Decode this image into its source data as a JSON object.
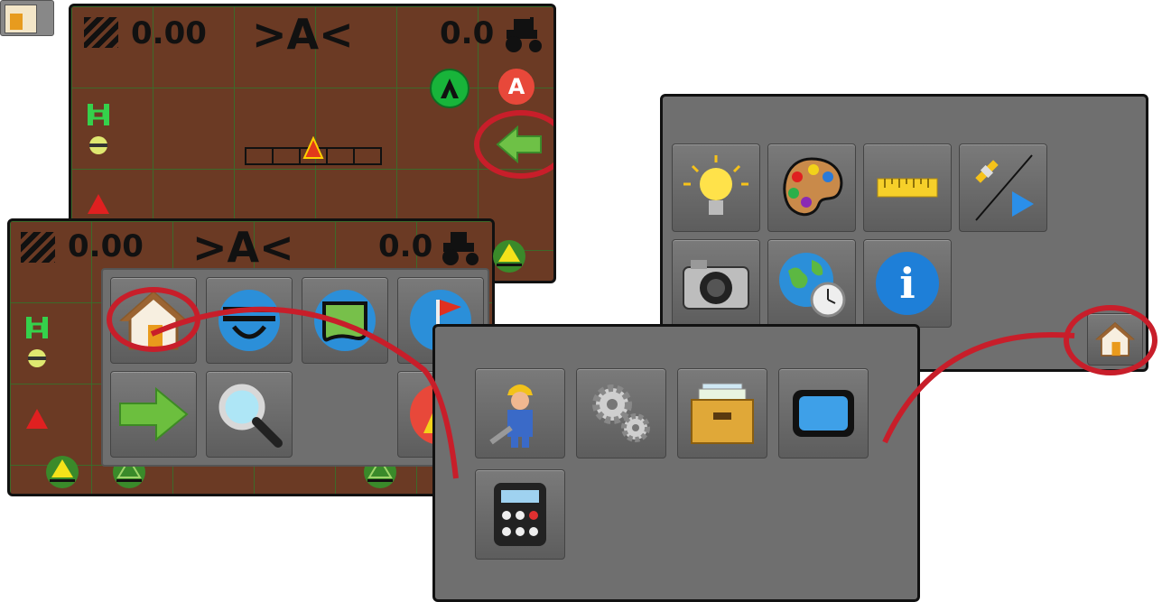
{
  "screen_a": {
    "rate": "0.00",
    "guidance": ">A<",
    "speed": "0.0"
  },
  "screen_b": {
    "rate": "0.00",
    "guidance": ">A<",
    "speed": "0.0"
  },
  "main_menu": {
    "tiles": [
      "home-icon",
      "steering-icon",
      "field-boundary-icon",
      "marker-flag-icon",
      "next-arrow-icon",
      "magnifier-icon"
    ]
  },
  "home_menu": {
    "tiles": [
      "lightbulb-icon",
      "palette-icon",
      "ruler-icon",
      "gps-icon",
      "camera-icon",
      "globe-clock-icon",
      "info-icon"
    ]
  },
  "system_menu": {
    "tiles": [
      "worker-icon",
      "gears-icon",
      "file-box-icon",
      "display-icon",
      "calculator-icon"
    ]
  },
  "info_glyph": "i",
  "a_marker": "A",
  "colors": {
    "field": "#6b3a24",
    "grid": "#3d6a2a",
    "highlight": "#c81e2a",
    "menu": "#6f6f6f"
  }
}
